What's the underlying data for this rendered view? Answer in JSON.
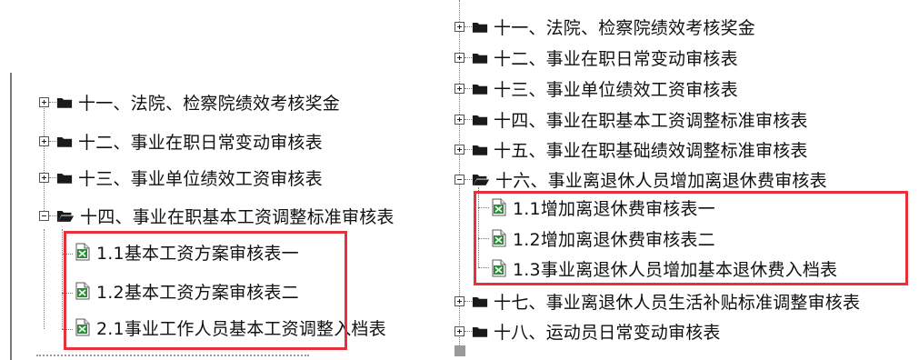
{
  "left_tree": {
    "items": [
      {
        "label": "十一、法院、检察院绩效考核奖金",
        "state": "collapsed"
      },
      {
        "label": "十二、事业在职日常变动审核表",
        "state": "collapsed"
      },
      {
        "label": "十三、事业单位绩效工资审核表",
        "state": "collapsed"
      },
      {
        "label": "十四、事业在职基本工资调整标准审核表",
        "state": "expanded"
      }
    ],
    "children": [
      {
        "label": "1.1基本工资方案审核表一",
        "icon": "excel-file-icon"
      },
      {
        "label": "1.2基本工资方案审核表二",
        "icon": "excel-file-icon"
      },
      {
        "label": "2.1事业工作人员基本工资调整入档表",
        "icon": "excel-file-icon"
      }
    ]
  },
  "right_tree": {
    "items": [
      {
        "label": "十一、法院、检察院绩效考核奖金",
        "state": "collapsed"
      },
      {
        "label": "十二、事业在职日常变动审核表",
        "state": "collapsed"
      },
      {
        "label": "十三、事业单位绩效工资审核表",
        "state": "collapsed"
      },
      {
        "label": "十四、事业在职基本工资调整标准审核表",
        "state": "collapsed"
      },
      {
        "label": "十五、事业在职基础绩效调整标准审核表",
        "state": "collapsed"
      },
      {
        "label": "十六、事业离退休人员增加离退休费审核表",
        "state": "expanded"
      }
    ],
    "children": [
      {
        "label": "1.1增加离退休费审核表一",
        "icon": "excel-file-icon"
      },
      {
        "label": "1.2增加离退休费审核表二",
        "icon": "excel-file-icon"
      },
      {
        "label": "1.3事业离退休人员增加基本退休费入档表",
        "icon": "excel-file-icon"
      }
    ],
    "after_items": [
      {
        "label": "十七、事业离退休人员生活补贴标准调整审核表",
        "state": "collapsed"
      },
      {
        "label": "十八、运动员日常变动审核表",
        "state": "collapsed"
      }
    ]
  },
  "colors": {
    "highlight_border": "#e8303a",
    "folder": "#1a1a1a",
    "excel_green": "#2e8b3a"
  }
}
